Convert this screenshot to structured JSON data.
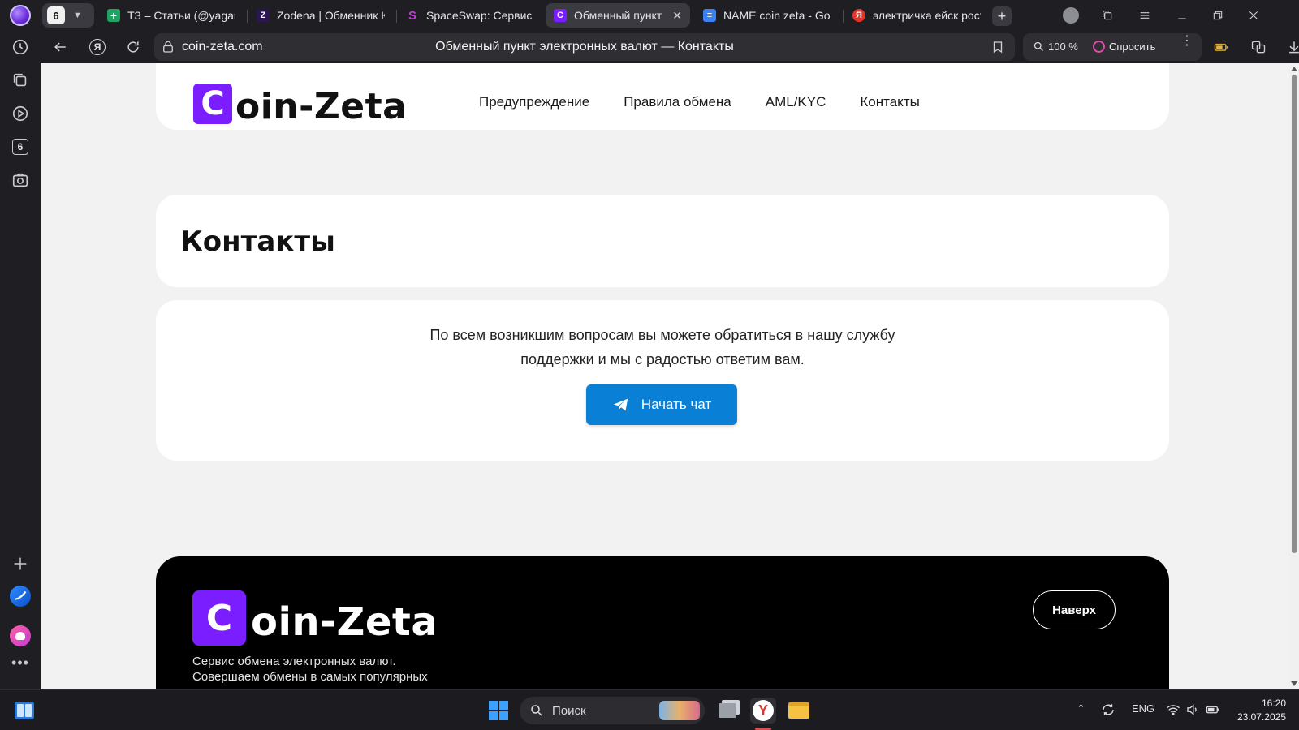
{
  "browser": {
    "tab_count": "6",
    "tabs": [
      {
        "title": "ТЗ – Статьи (@yagami",
        "favicon": "green-sheet",
        "color": "#1ea362",
        "glyph": "+"
      },
      {
        "title": "Zodena | Обменник Кр",
        "favicon": "zodena",
        "color": "#2a1650",
        "glyph": "Z"
      },
      {
        "title": "SpaceSwap: Сервис бы",
        "favicon": "spaceswap",
        "color": "#c03ad8",
        "glyph": "S"
      },
      {
        "title": "Обменный пункт эл",
        "favicon": "coin-zeta",
        "color": "#7a1dff",
        "glyph": "C"
      },
      {
        "title": "NAME coin zeta - Goog",
        "favicon": "google-doc",
        "color": "#3b82f6",
        "glyph": "≡"
      },
      {
        "title": "электричка ейск рост",
        "favicon": "yandex",
        "color": "#e5352b",
        "glyph": "Я"
      }
    ],
    "address": {
      "url": "coin-zeta.com",
      "page_title": "Обменный пункт электронных валют — Контакты"
    },
    "zoom": "100 %",
    "ask_label": "Спросить"
  },
  "site": {
    "logo_letter": "C",
    "logo_word": "oin-Zeta",
    "nav": [
      "Предупреждение",
      "Правила обмена",
      "AML/KYC",
      "Контакты"
    ],
    "page_heading": "Контакты",
    "message_line1": "По всем возникшим вопросам вы можете обратиться в нашу службу",
    "message_line2": "поддержки и мы с радостью ответим вам.",
    "chat_button": "Начать чат",
    "footer": {
      "tagline": "Сервис обмена электронных валют. Совершаем обмены в самых популярных направлениях",
      "top_button": "Наверх"
    },
    "colors": {
      "brand": "#7a1dff",
      "chat_button": "#0a7fd6"
    }
  },
  "taskbar": {
    "search_label": "Поиск",
    "language": "ENG",
    "time": "16:20",
    "date": "23.07.2025"
  }
}
